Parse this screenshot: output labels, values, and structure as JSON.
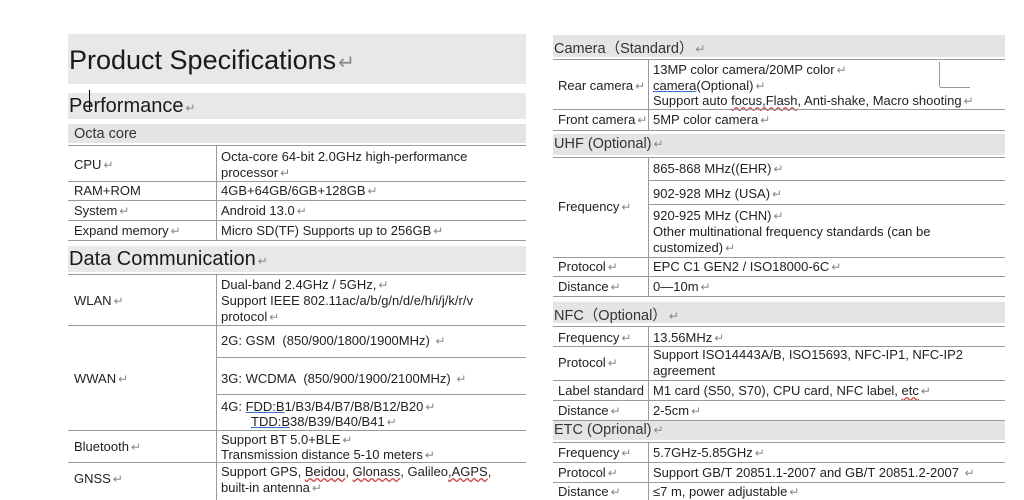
{
  "left": {
    "title": "Product Specifications",
    "performance": "Performance",
    "octa_core": "Octa core",
    "perf_rows": {
      "cpu_label": "CPU",
      "cpu_line1": "Octa-core 64-bit 2.0GHz high-performance",
      "cpu_line2": "processor",
      "ram_label": "RAM+ROM",
      "ram_value": "4GB+64GB/6GB+128GB",
      "system_label": "System",
      "system_value": "Android 13.0",
      "expand_label": "Expand memory",
      "expand_value": "Micro SD(TF) Supports up to 256GB"
    },
    "data_comm": "Data Communication",
    "comm_rows": {
      "wlan_label": "WLAN",
      "wlan_line1": "Dual-band 2.4GHz / 5GHz,",
      "wlan_line2": "Support IEEE 802.11ac/a/b/g/n/d/e/h/i/j/k/r/v",
      "wlan_line3": "protocol",
      "wwan_label": "WWAN",
      "wwan_2g": "2G:  GSM  (850/900/1800/1900MHz)",
      "wwan_3g": "3G:  WCDMA  (850/900/1900/2100MHz)",
      "wwan_4g_prefix": "4G: ",
      "wwan_fdd": "FDD:B",
      "wwan_fdd_rest": "1/B3/B4/B7/B8/B12/B20",
      "wwan_tdd": "TDD:B",
      "wwan_tdd_rest": "38/B39/B40/B41",
      "bt_label": "Bluetooth",
      "bt_line1": "Support BT 5.0+BLE",
      "bt_line2": "Transmission distance 5-10 meters",
      "gnss_label": "GNSS",
      "gnss_line1a": "Support  GPS,  ",
      "gnss_beidou": "Beidou",
      "gnss_mid": ",  ",
      "gnss_glonass": "Glonass",
      "gnss_line1b": ",  Galileo",
      "gnss_agps": ",AGPS",
      "gnss_comma": ",",
      "gnss_line2": "built-in antenna"
    }
  },
  "right": {
    "camera_title": "Camera（Standard）",
    "rear_label": "Rear camera",
    "rear_line1": "13MP color camera/20MP color",
    "rear_camera_word": "camera",
    "rear_line2_rest": "(Optional)",
    "rear_line3a": "Support auto ",
    "rear_focus": "focus,Flash",
    "rear_line3b": ", Anti-shake, Macro shooting",
    "front_label": "Front camera",
    "front_value": "5MP color camera",
    "uhf_title": "UHF (Optional)",
    "freq_label": "Frequency",
    "uhf_f1": "865-868 MHz((EHR)",
    "uhf_f2": "902-928 MHz (USA)",
    "uhf_f3": "920-925 MHz (CHN)",
    "uhf_f4": "Other multinational frequency standards (can be",
    "uhf_f5": "customized)",
    "protocol_label": "Protocol",
    "uhf_protocol": "EPC C1 GEN2 / ISO18000-6C",
    "distance_label": "Distance",
    "uhf_distance": "0—10m",
    "nfc_title": "NFC（Optional）",
    "nfc_freq": "13.56MHz",
    "nfc_proto1": "Support ISO14443A/B, ISO15693, NFC-IP1, NFC-IP2",
    "nfc_proto2": "agreement",
    "label_std_label": "Label standard",
    "label_std_a": "M1 card (S50, S70), CPU card, NFC label, ",
    "label_std_etc": "etc",
    "nfc_distance": "2-5cm",
    "etc_title": "ETC (Oprional)",
    "etc_freq": "5.7GHz-5.85GHz",
    "etc_proto": "Support GB/T 20851.1-2007 and GB/T 20851.2-2007",
    "etc_distance": "≤7 m, power adjustable"
  },
  "return_mark": "↵"
}
